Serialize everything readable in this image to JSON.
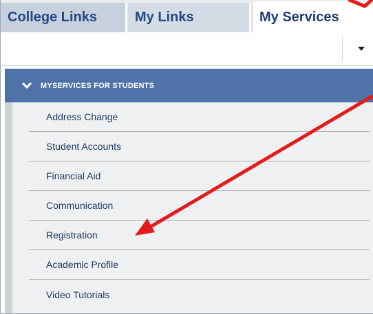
{
  "tabs": [
    {
      "label": "College Links"
    },
    {
      "label": "My Links"
    },
    {
      "label": "My Services"
    }
  ],
  "section": {
    "title": "MYSERVICES FOR STUDENTS",
    "icon": "chevron-down-icon"
  },
  "menu": {
    "items": [
      {
        "label": "Address Change"
      },
      {
        "label": "Student Accounts"
      },
      {
        "label": "Financial Aid"
      },
      {
        "label": "Communication"
      },
      {
        "label": "Registration"
      },
      {
        "label": "Academic Profile"
      },
      {
        "label": "Video Tutorials"
      }
    ]
  },
  "colors": {
    "header_blue": "#4f72a8",
    "tab_text": "#234a86",
    "annotation_red": "#e31b1b"
  }
}
